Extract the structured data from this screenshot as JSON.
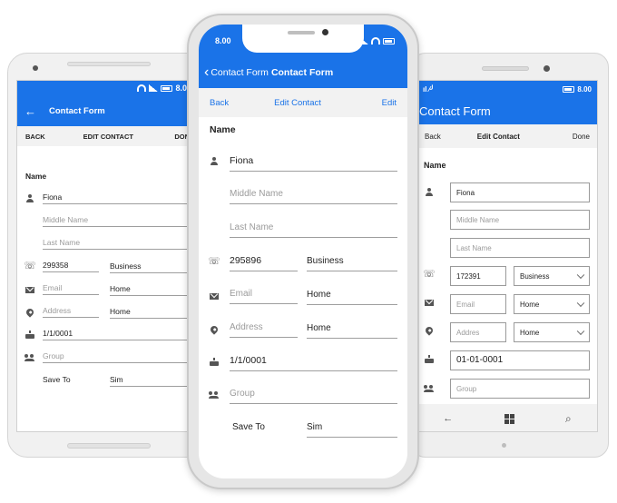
{
  "android": {
    "status_time": "8.00",
    "title": "Contact Form",
    "back_arrow": "←",
    "toolbar": {
      "back": "BACK",
      "title": "EDIT CONTACT",
      "done": "DONE"
    },
    "section": "Name",
    "first_name": "Fiona",
    "middle_placeholder": "Middle Name",
    "last_placeholder": "Last Name",
    "phone": "299358",
    "phone_type": "Business",
    "email_placeholder": "Email",
    "email_type": "Home",
    "address_placeholder": "Address",
    "address_type": "Home",
    "birthday": "1/1/0001",
    "group_placeholder": "Group",
    "save_to_label": "Save To",
    "save_to_value": "Sim"
  },
  "iphone": {
    "status_time": "8.00",
    "nav_back": "Contact Form",
    "nav_title": "Contact Form",
    "toolbar": {
      "back": "Back",
      "title": "Edit Contact",
      "edit": "Edit"
    },
    "section": "Name",
    "first_name": "Fiona",
    "middle_placeholder": "Middle Name",
    "last_placeholder": "Last Name",
    "phone": "295896",
    "phone_type": "Business",
    "email_placeholder": "Email",
    "email_type": "Home",
    "address_placeholder": "Address",
    "address_type": "Home",
    "birthday": "1/1/0001",
    "group_placeholder": "Group",
    "save_to_label": "Save To",
    "save_to_value": "Sim"
  },
  "winphone": {
    "status_left": "ıl ⁄╯",
    "status_time": "8.00",
    "title": "Contact Form",
    "toolbar": {
      "back": "Back",
      "title": "Edit Contact",
      "done": "Done"
    },
    "section": "Name",
    "first_name": "Fiona",
    "middle_placeholder": "Middle Name",
    "last_placeholder": "Last Name",
    "phone": "172391",
    "phone_type": "Business",
    "email_placeholder": "Email",
    "email_type": "Home",
    "address_placeholder": "Addres",
    "address_type": "Home",
    "birthday": "01-01-0001",
    "group_placeholder": "Group",
    "nav_back": "←",
    "nav_search": "⌕"
  },
  "colors": {
    "accent": "#1a73e8",
    "text": "#222222",
    "placeholder": "#9b9b9b"
  }
}
